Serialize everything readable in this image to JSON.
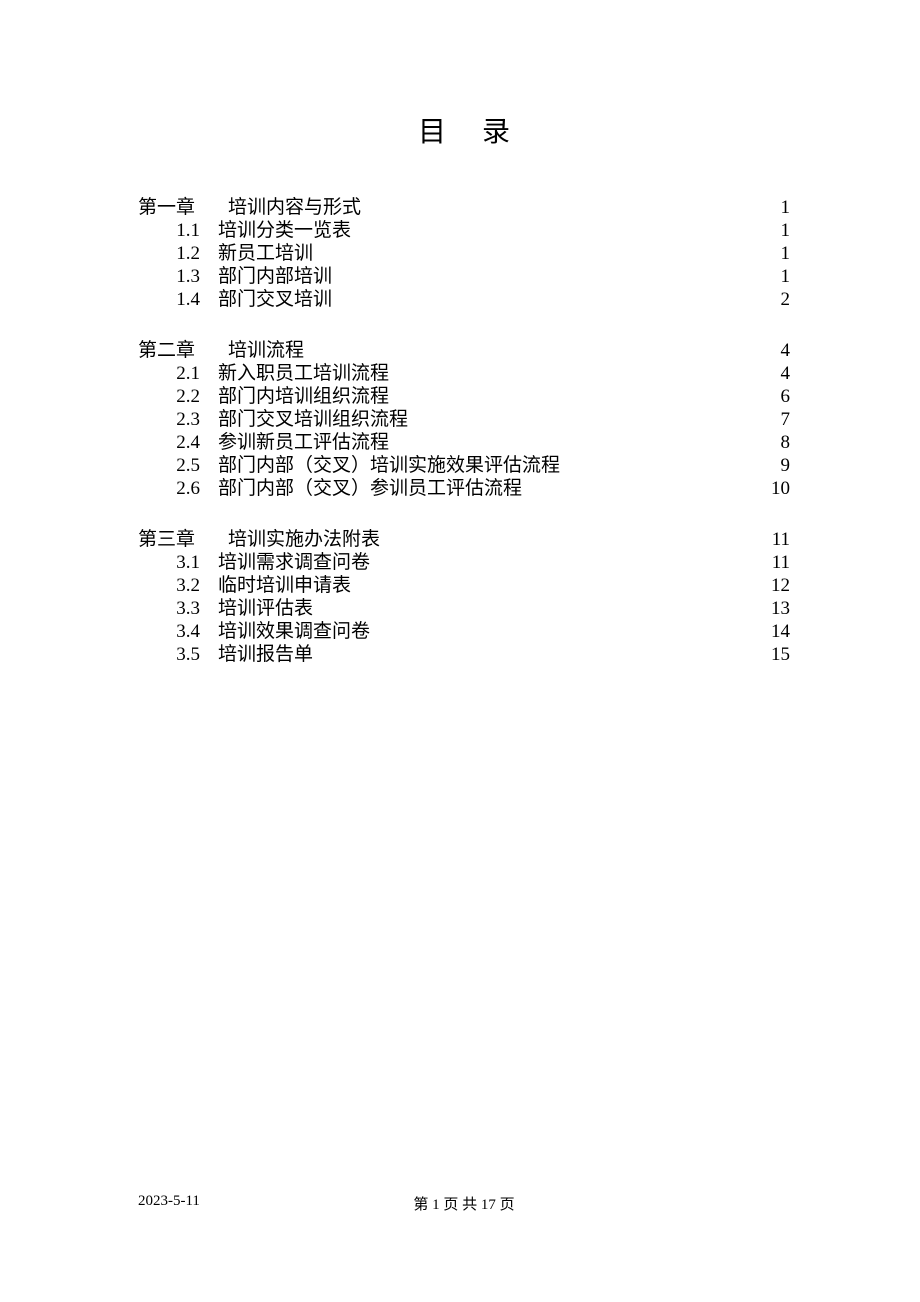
{
  "title": "目录",
  "chapters": [
    {
      "label": "第一章",
      "title": "培训内容与形式",
      "page": "1",
      "sections": [
        {
          "num": "1.1",
          "title": "培训分类一览表",
          "page": "1"
        },
        {
          "num": "1.2",
          "title": "新员工培训",
          "page": "1"
        },
        {
          "num": "1.3",
          "title": "部门内部培训",
          "page": "1"
        },
        {
          "num": "1.4",
          "title": "部门交叉培训",
          "page": "2"
        }
      ]
    },
    {
      "label": "第二章",
      "title": "培训流程",
      "page": "4",
      "sections": [
        {
          "num": "2.1",
          "title": "新入职员工培训流程",
          "page": "4"
        },
        {
          "num": "2.2",
          "title": "部门内培训组织流程",
          "page": "6"
        },
        {
          "num": "2.3",
          "title": "部门交叉培训组织流程",
          "page": "7"
        },
        {
          "num": "2.4",
          "title": "参训新员工评估流程",
          "page": "8"
        },
        {
          "num": "2.5",
          "title": "部门内部（交叉）培训实施效果评估流程",
          "page": "9"
        },
        {
          "num": "2.6",
          "title": "部门内部（交叉）参训员工评估流程",
          "page": "10"
        }
      ]
    },
    {
      "label": "第三章",
      "title": "培训实施办法附表",
      "page": "11",
      "sections": [
        {
          "num": "3.1",
          "title": "培训需求调查问卷",
          "page": "11"
        },
        {
          "num": "3.2",
          "title": "临时培训申请表",
          "page": "12"
        },
        {
          "num": "3.3",
          "title": "培训评估表",
          "page": "13"
        },
        {
          "num": "3.4",
          "title": "培训效果调查问卷",
          "page": "14"
        },
        {
          "num": "3.5",
          "title": "培训报告单",
          "page": "15"
        }
      ]
    }
  ],
  "footer": {
    "date": "2023-5-11",
    "pagination": "第 1 页 共 17 页"
  }
}
